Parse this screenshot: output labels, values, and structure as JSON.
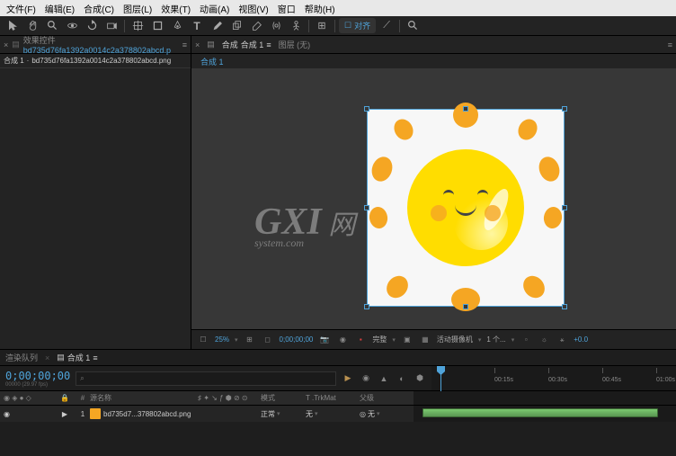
{
  "menu": {
    "file": "文件(F)",
    "edit": "编辑(E)",
    "comp": "合成(C)",
    "layer": "图层(L)",
    "effect": "效果(T)",
    "animation": "动画(A)",
    "view": "视图(V)",
    "window": "窗口",
    "help": "帮助(H)"
  },
  "toolbar": {
    "tab_snap": "对齐"
  },
  "effects_panel": {
    "title_prefix": "效果控件",
    "filename_long": "bd735d76fa1392a0014c2a378802abcd.p",
    "comp_name": "合成 1",
    "layer_name": "bd735d76fa1392a0014c2a378802abcd.png"
  },
  "viewer": {
    "layer_tab": "图层 (无)",
    "comp_tab_prefix": "合成",
    "comp_name": "合成 1",
    "sub": "合成 1"
  },
  "viewer_footer": {
    "zoom": "25%",
    "time": "0;00;00;00",
    "resolution": "完整",
    "camera": "活动摄像机",
    "view_count": "1 个...",
    "angle": "+0.0"
  },
  "timeline": {
    "render_queue": "渲染队列",
    "comp_tab": "合成 1",
    "timecode": "0;00;00;00",
    "framerate": "00000 (29.97 fps)",
    "col_source": "源名称",
    "col_mode": "模式",
    "col_trkmat": "T .TrkMat",
    "col_parent": "父级",
    "layer_num": "1",
    "layer_name": "bd735d7...378802abcd.png",
    "mode_val": "正常",
    "trkmat_val": "无",
    "parent_val": "无",
    "ticks": [
      "00:15s",
      "00:30s",
      "00:45s",
      "01:00s"
    ]
  },
  "watermark": {
    "line1": "GXI",
    "suffix": "网",
    "line2": "system.com"
  }
}
